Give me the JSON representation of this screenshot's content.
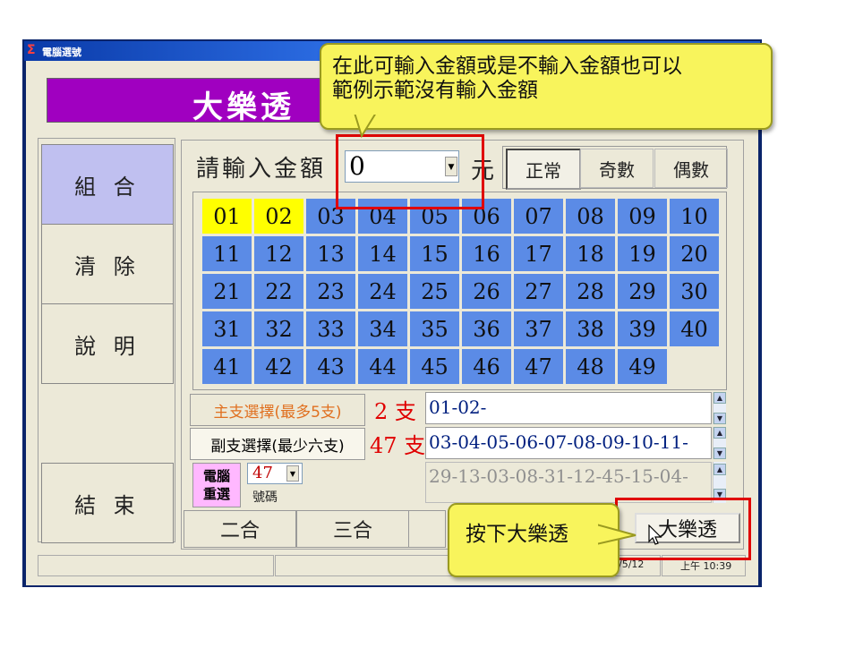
{
  "window": {
    "title": "電腦選號"
  },
  "banner": {
    "title": "大樂透"
  },
  "sidebar": {
    "combo": "組 合",
    "clear": "清 除",
    "help": "說 明",
    "exit": "結 束"
  },
  "amount": {
    "label": "請輸入金額",
    "value": "0",
    "unit": "元"
  },
  "modes": {
    "normal": "正常",
    "odd": "奇數",
    "even": "偶數"
  },
  "numbers": [
    "01",
    "02",
    "03",
    "04",
    "05",
    "06",
    "07",
    "08",
    "09",
    "10",
    "11",
    "12",
    "13",
    "14",
    "15",
    "16",
    "17",
    "18",
    "19",
    "20",
    "21",
    "22",
    "23",
    "24",
    "25",
    "26",
    "27",
    "28",
    "29",
    "30",
    "31",
    "32",
    "33",
    "34",
    "35",
    "36",
    "37",
    "38",
    "39",
    "40",
    "41",
    "42",
    "43",
    "44",
    "45",
    "46",
    "47",
    "48",
    "49"
  ],
  "selected": [
    "01",
    "02"
  ],
  "main": {
    "label": "主支選擇(最多5支)",
    "count": "2 支",
    "value": "01-02-"
  },
  "sub": {
    "label": "副支選擇(最少六支)",
    "count": "47 支",
    "value": "03-04-05-06-07-08-09-10-11-"
  },
  "computer": {
    "label_line1": "電腦",
    "label_line2": "重選",
    "value": "47",
    "unit": "號碼",
    "result": "29-13-03-08-31-12-45-15-04-"
  },
  "tabs": {
    "two": "二合",
    "three": "三合"
  },
  "action": {
    "big_button": "大樂透"
  },
  "status": {
    "date": "2014/5/12",
    "time": "上午 10:39"
  },
  "callouts": {
    "amount_line1": "在此可輸入金額或是不輸入金額也可以",
    "amount_line2": "範例示範沒有輸入金額",
    "press": "按下大樂透"
  },
  "colors": {
    "highlight": "#ffff00",
    "number": "#5b8be6",
    "banner": "#a000c0",
    "callout": "#f8f45c",
    "marker": "#e00000"
  }
}
